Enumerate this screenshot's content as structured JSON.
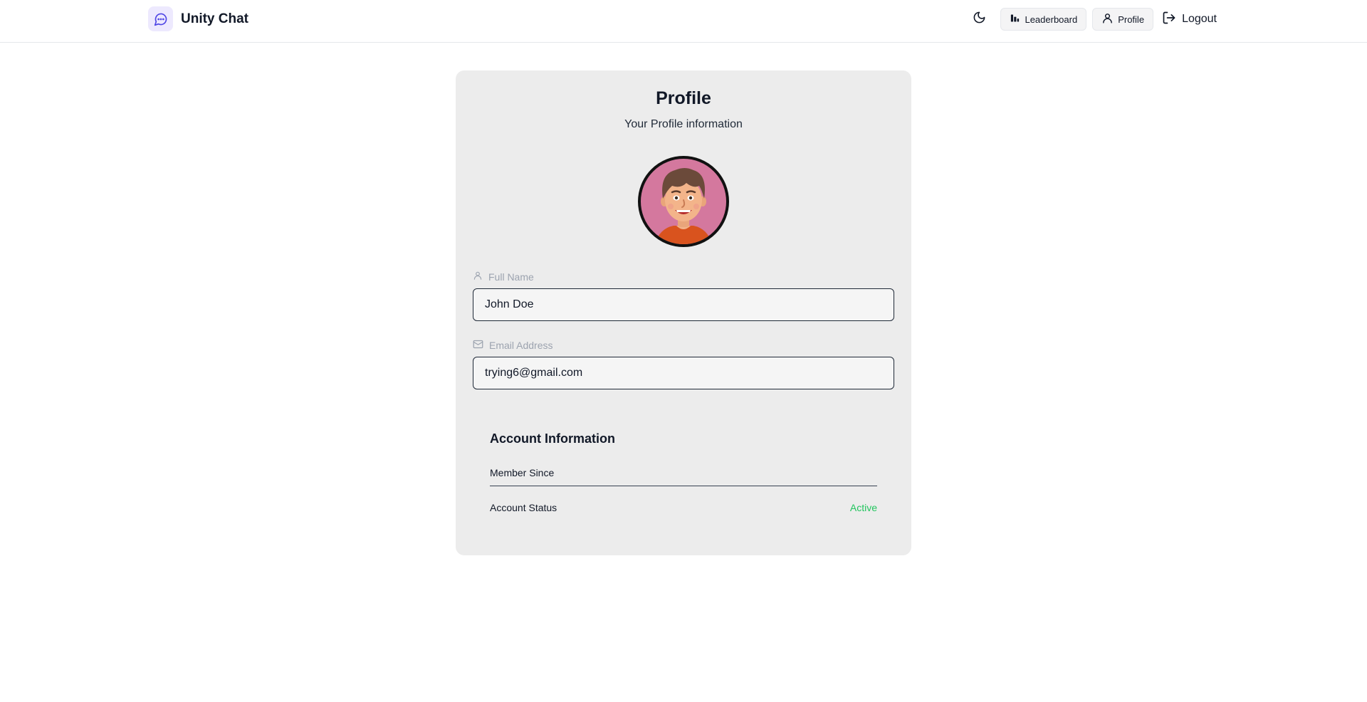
{
  "header": {
    "brand_name": "Unity Chat",
    "leaderboard_label": "Leaderboard",
    "profile_label": "Profile",
    "logout_label": "Logout"
  },
  "profile": {
    "title": "Profile",
    "subtitle": "Your Profile information",
    "full_name_label": "Full Name",
    "full_name_value": "John Doe",
    "email_label": "Email Address",
    "email_value": "trying6@gmail.com"
  },
  "account": {
    "title": "Account Information",
    "member_since_label": "Member Since",
    "member_since_value": "",
    "status_label": "Account Status",
    "status_value": "Active"
  },
  "colors": {
    "accent": "#6d28d9",
    "status_active": "#22c55e",
    "card_bg": "#ececec"
  },
  "icons": [
    "chat-bubble-icon",
    "moon-icon",
    "bar-chart-icon",
    "user-icon",
    "logout-icon",
    "mail-icon"
  ]
}
